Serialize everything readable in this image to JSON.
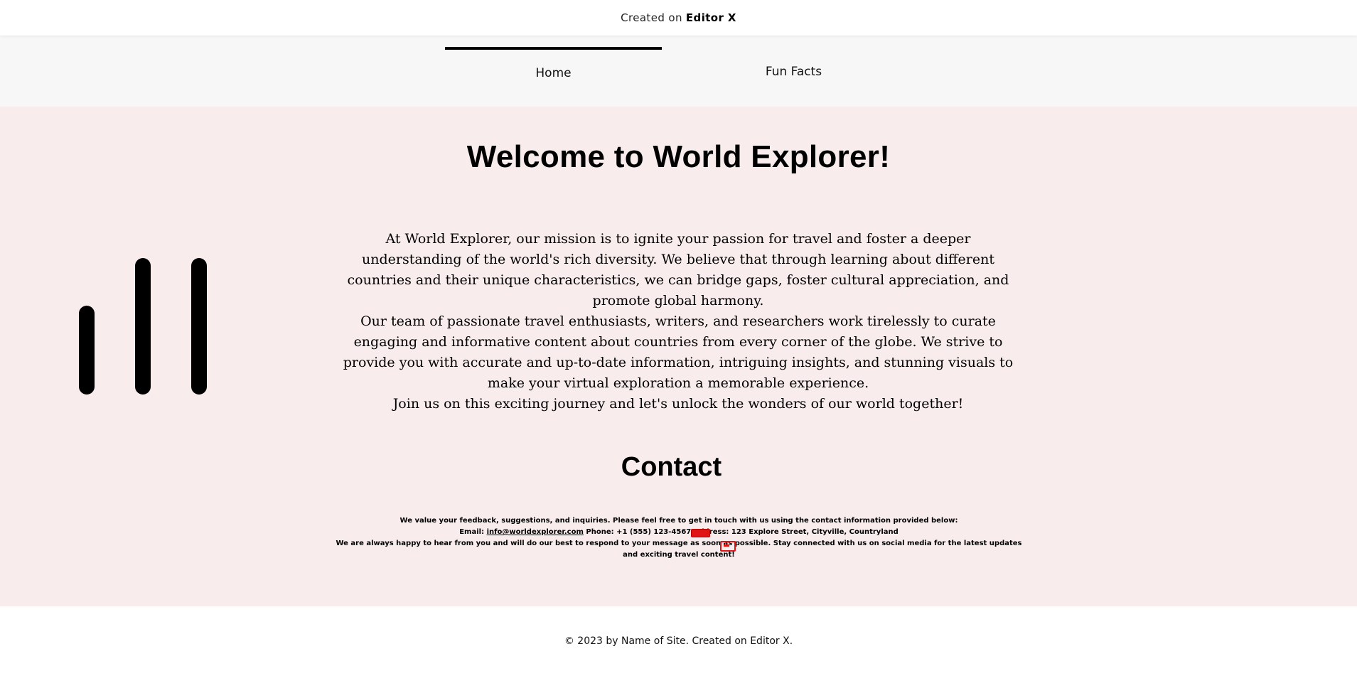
{
  "topbar": {
    "prefix": "Created on",
    "brand": "Editor X"
  },
  "nav": {
    "items": [
      {
        "label": "Home",
        "active": true
      },
      {
        "label": "Fun Facts",
        "active": false
      }
    ]
  },
  "hero": {
    "title": "Welcome to World Explorer!",
    "mission": [
      "At World Explorer, our mission is to ignite your passion for travel and foster a deeper understanding of the world's rich diversity. We believe that through learning about different countries and their unique characteristics, we can bridge gaps, foster cultural appreciation, and promote global harmony.",
      "Our team of passionate travel enthusiasts, writers, and researchers work tirelessly to curate engaging and informative content about countries from every corner of the globe. We strive to provide you with accurate and up-to-date information, intriguing insights, and stunning visuals to make your virtual exploration a memorable experience.",
      "Join us on this exciting journey and let's unlock the wonders of our world together!"
    ]
  },
  "contact": {
    "title": "Contact",
    "intro": "We value your feedback, suggestions, and inquiries. Please feel free to get in touch with us using the contact information provided below:",
    "email_label": "Email:",
    "email": "info@worldexplorer.com",
    "phone": "Phone: +1 (555) 123-4567",
    "address": "Address: 123 Explore Street, Cityville, Countryland",
    "closing": "We are always happy to hear from you and will do our best to respond to your message as soon as possible. Stay connected with us on social media for the latest updates and exciting travel content!"
  },
  "footer": {
    "text": "© 2023 by Name of Site. Created on Editor X."
  },
  "colors": {
    "hero_bg": "#f9ecec",
    "nav_bg": "#f7f7f7",
    "accent": "#000000",
    "marker": "#e01414"
  }
}
